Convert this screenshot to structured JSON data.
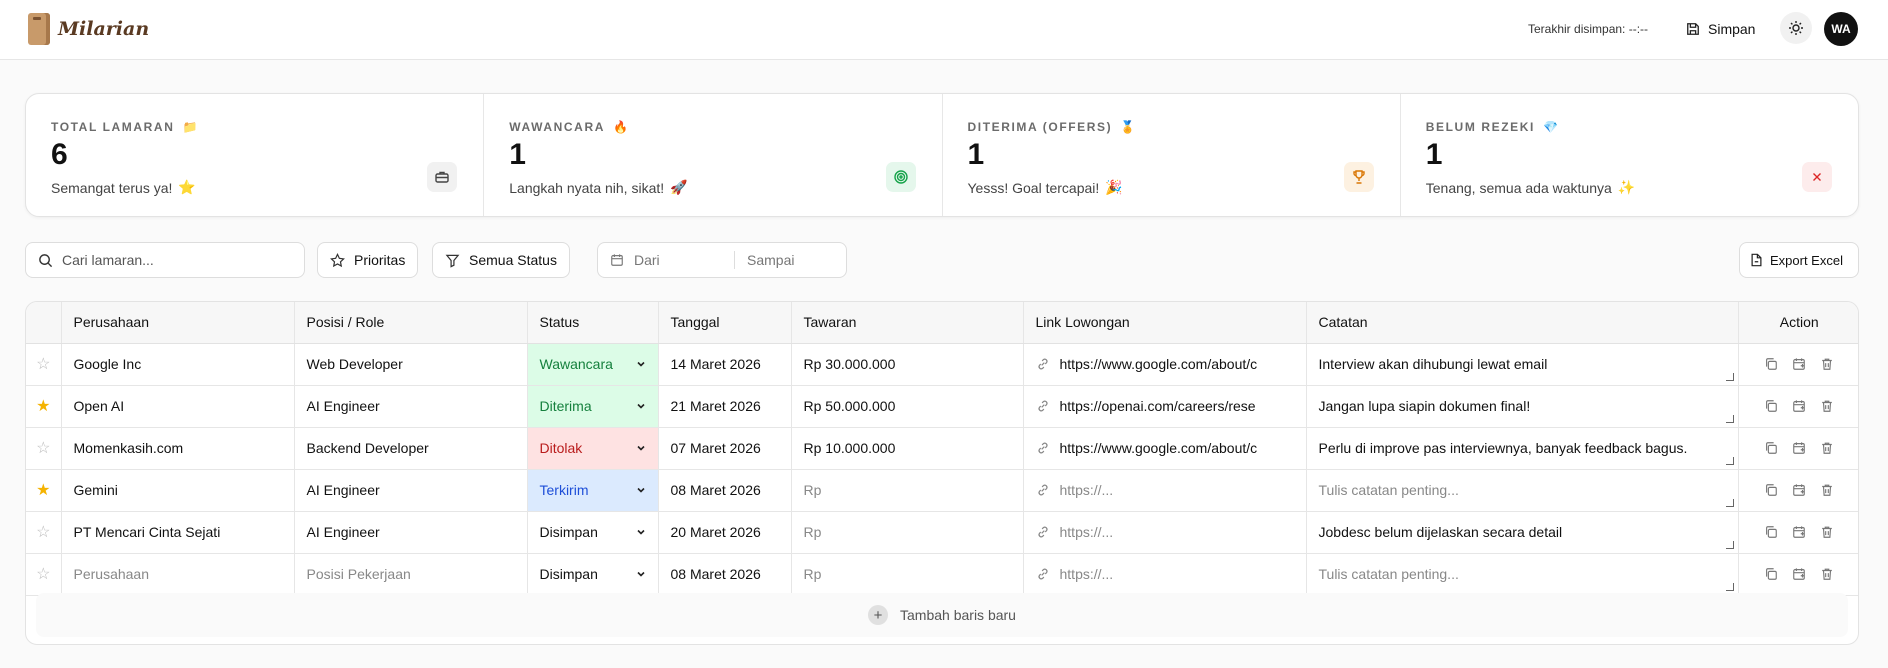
{
  "app": {
    "name": "Milarian"
  },
  "header": {
    "last_saved": "Terakhir disimpan: --:--",
    "save_label": "Simpan",
    "avatar_initials": "WA"
  },
  "stats": [
    {
      "label": "TOTAL LAMARAN",
      "emoji": "📁",
      "value": "6",
      "sub": "Semangat terus ya!",
      "sub_emoji": "⭐",
      "icon": "briefcase-icon",
      "icon_bg": "#f1f1f1",
      "icon_color": "#444"
    },
    {
      "label": "WAWANCARA",
      "emoji": "🔥",
      "value": "1",
      "sub": "Langkah nyata nih, sikat!",
      "sub_emoji": "🚀",
      "icon": "target-icon",
      "icon_bg": "#e5f7ec",
      "icon_color": "#16a34a"
    },
    {
      "label": "DITERIMA (OFFERS)",
      "emoji": "🏅",
      "value": "1",
      "sub": "Yesss! Goal tercapai!",
      "sub_emoji": "🎉",
      "icon": "trophy-icon",
      "icon_bg": "#fdf1e1",
      "icon_color": "#d97706"
    },
    {
      "label": "BELUM REZEKI",
      "emoji": "💎",
      "value": "1",
      "sub": "Tenang, semua ada waktunya",
      "sub_emoji": "✨",
      "icon": "close-icon",
      "icon_bg": "#fdecec",
      "icon_color": "#dc2626"
    }
  ],
  "toolbar": {
    "search_placeholder": "Cari lamaran...",
    "priority_label": "Prioritas",
    "status_filter_label": "Semua Status",
    "date_from": "Dari",
    "date_to": "Sampai",
    "export_label": "Export Excel"
  },
  "table": {
    "headers": {
      "company": "Perusahaan",
      "role": "Posisi / Role",
      "status": "Status",
      "date": "Tanggal",
      "offer": "Tawaran",
      "link": "Link Lowongan",
      "notes": "Catatan",
      "action": "Action"
    },
    "rows": [
      {
        "starred": false,
        "company": "Google Inc",
        "role": "Web Developer",
        "status": "Wawancara",
        "status_class": "s-wawancara",
        "date": "14 Maret 2026",
        "offer": "Rp 30.000.000",
        "link": "https://www.google.com/about/c",
        "notes": "Interview akan dihubungi lewat email"
      },
      {
        "starred": true,
        "company": "Open AI",
        "role": "AI Engineer",
        "status": "Diterima",
        "status_class": "s-diterima",
        "date": "21 Maret 2026",
        "offer": "Rp 50.000.000",
        "link": "https://openai.com/careers/rese",
        "notes": "Jangan lupa siapin dokumen final!"
      },
      {
        "starred": false,
        "company": "Momenkasih.com",
        "role": "Backend Developer",
        "status": "Ditolak",
        "status_class": "s-ditolak",
        "date": "07 Maret 2026",
        "offer": "Rp 10.000.000",
        "link": "https://www.google.com/about/c",
        "notes": "Perlu di improve pas interviewnya, banyak feedback bagus."
      },
      {
        "starred": true,
        "company": "Gemini",
        "role": "AI Engineer",
        "status": "Terkirim",
        "status_class": "s-terkirim",
        "date": "08 Maret 2026",
        "offer": "Rp",
        "offer_muted": true,
        "link": "https://...",
        "link_muted": true,
        "notes": "Tulis catatan penting...",
        "notes_muted": true
      },
      {
        "starred": false,
        "company": "PT Mencari Cinta Sejati",
        "role": "AI Engineer",
        "status": "Disimpan",
        "status_class": "",
        "date": "20 Maret 2026",
        "offer": "Rp",
        "offer_muted": true,
        "link": "https://...",
        "link_muted": true,
        "notes": "Jobdesc belum dijelaskan secara detail"
      },
      {
        "starred": false,
        "company": "Perusahaan",
        "company_muted": true,
        "role": "Posisi Pekerjaan",
        "role_muted": true,
        "status": "Disimpan",
        "status_class": "",
        "date": "08 Maret 2026",
        "offer": "Rp",
        "offer_muted": true,
        "link": "https://...",
        "link_muted": true,
        "notes": "Tulis catatan penting...",
        "notes_muted": true
      }
    ],
    "add_row_label": "Tambah baris baru"
  }
}
